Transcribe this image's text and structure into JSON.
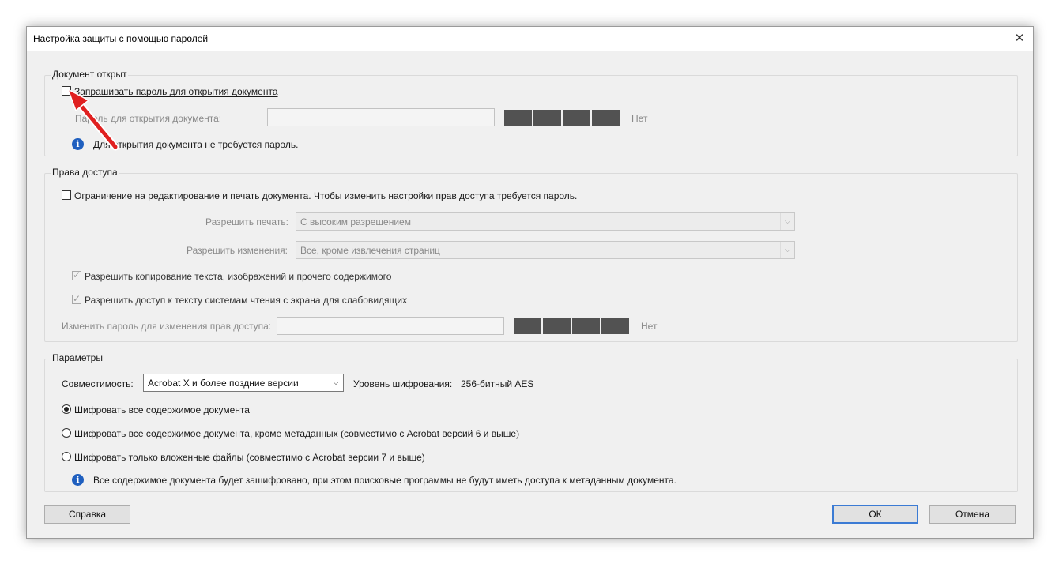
{
  "dialog": {
    "title": "Настройка защиты с помощью паролей",
    "close_glyph": "✕"
  },
  "open_section": {
    "legend": "Документ открыт",
    "require_password_label": "Запрашивать пароль для открытия документа",
    "require_password_checked": false,
    "password_label": "Пароль для открытия документа:",
    "password_value": "",
    "strength_text": "Нет",
    "info_text": "Для открытия документа не требуется пароль."
  },
  "permissions_section": {
    "legend": "Права доступа",
    "restrict_label": "Ограничение на редактирование и печать документа. Чтобы изменить настройки прав доступа требуется пароль.",
    "restrict_checked": false,
    "printing_label": "Разрешить печать:",
    "printing_value": "С высоким разрешением",
    "changes_label": "Разрешить изменения:",
    "changes_value": "Все, кроме извлечения страниц",
    "copy_label": "Разрешить копирование текста, изображений и прочего содержимого",
    "copy_checked": true,
    "screen_reader_label": "Разрешить доступ к тексту системам чтения с экрана для слабовидящих",
    "screen_reader_checked": true,
    "change_password_label": "Изменить пароль для изменения прав доступа:",
    "change_password_value": "",
    "strength_text": "Нет"
  },
  "params_section": {
    "legend": "Параметры",
    "compat_label": "Совместимость:",
    "compat_value": "Acrobat X и более поздние версии",
    "encryption_level_label": "Уровень шифрования:",
    "encryption_level_value": "256-битный AES",
    "radio_all": "Шифровать все содержимое документа",
    "radio_except_meta": "Шифровать все содержимое документа, кроме метаданных (совместимо с Acrobat версий 6 и выше)",
    "radio_attachments": "Шифровать только вложенные файлы (совместимо с Acrobat версии 7 и выше)",
    "selected_radio": "all",
    "info_text": "Все содержимое документа будет зашифровано, при этом поисковые программы не будут иметь доступа к метаданным документа."
  },
  "buttons": {
    "help": "Справка",
    "ok": "ОК",
    "cancel": "Отмена"
  },
  "icons": {
    "info": "info-icon",
    "close": "close-icon",
    "dropdown": "chevron-down-icon",
    "annotation": "red-arrow-annotation"
  },
  "colors": {
    "dialog_bg": "#f0f0f0",
    "strength_meter": "#525252",
    "info_icon": "#1f5fbf",
    "default_button_border": "#3b7bd4",
    "annotation_arrow": "#e02020"
  }
}
